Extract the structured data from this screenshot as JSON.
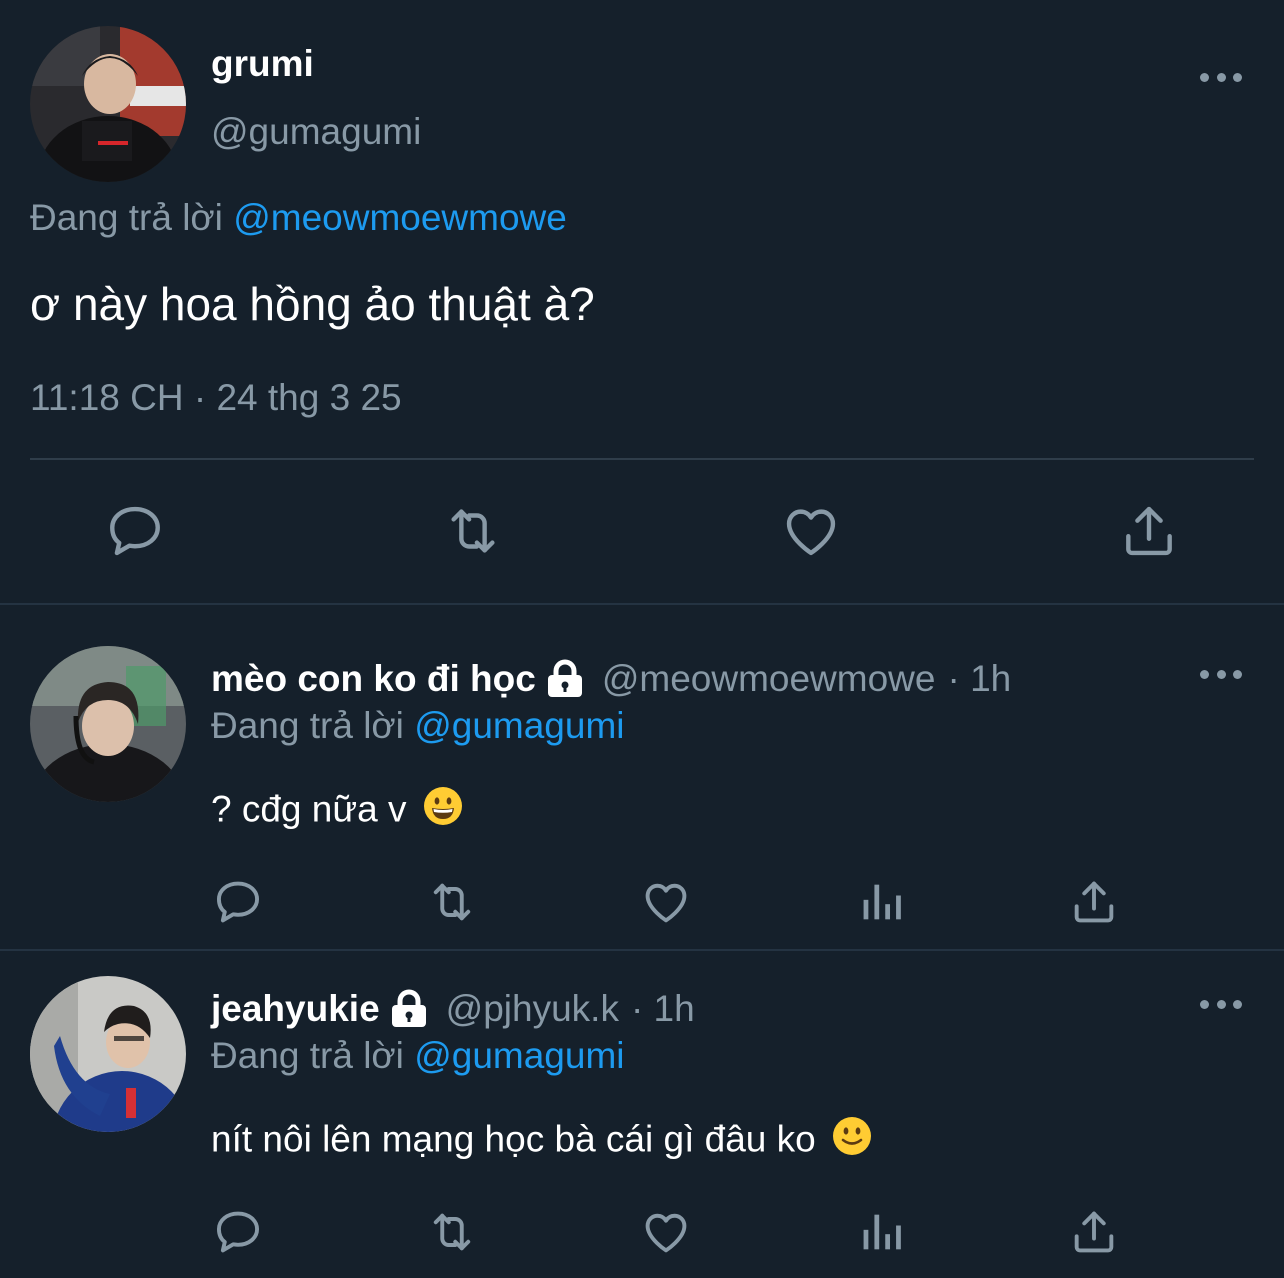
{
  "main_tweet": {
    "display_name": "grumi",
    "handle": "@gumagumi",
    "replying_label": "Đang trả lời",
    "replying_to": "@meowmoewmowe",
    "text": "ơ này hoa hồng ảo thuật à?",
    "timestamp": "11:18 CH · 24 thg 3 25",
    "actions": [
      "reply-icon",
      "retweet-icon",
      "like-icon",
      "share-icon"
    ]
  },
  "replies": [
    {
      "display_name": "mèo con ko đi học",
      "locked": true,
      "handle": "@meowmoewmowe",
      "time": "· 1h",
      "replying_label": "Đang trả lời",
      "replying_to": "@gumagumi",
      "text": "? cđg nữa v",
      "emoji": "grinning-face",
      "actions": [
        "reply-icon",
        "retweet-icon",
        "like-icon",
        "analytics-icon",
        "share-icon"
      ]
    },
    {
      "display_name": "jeahyukie",
      "locked": true,
      "handle": "@pjhyuk.k",
      "time": "· 1h",
      "replying_label": "Đang trả lời",
      "replying_to": "@gumagumi",
      "text": "nít nôi lên mạng học bà cái gì đâu ko",
      "emoji": "slightly-smiling-face",
      "actions": [
        "reply-icon",
        "retweet-icon",
        "like-icon",
        "analytics-icon",
        "share-icon"
      ]
    }
  ],
  "colors": {
    "background": "#15202b",
    "text": "#ffffff",
    "secondary": "#8899a6",
    "link": "#1d9bf0",
    "divider": "#243342"
  }
}
